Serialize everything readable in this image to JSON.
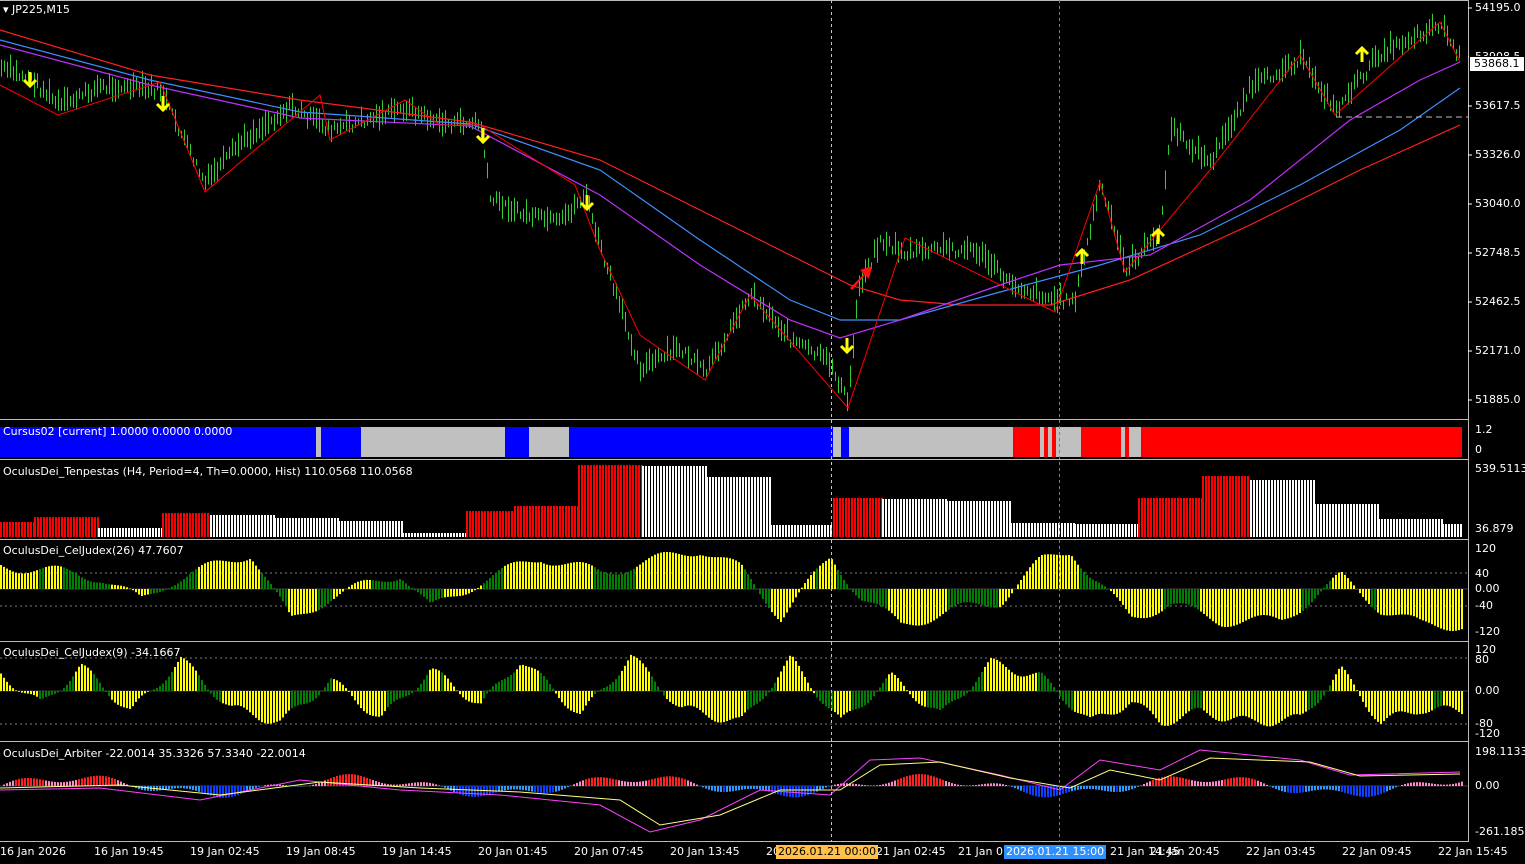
{
  "window": {
    "symbol_title": "JP225,M15",
    "current_price_label": "53868.1"
  },
  "main_axis": {
    "labels": [
      "54195.0",
      "53908.5",
      "53617.5",
      "53326.0",
      "53040.0",
      "52748.5",
      "52462.5",
      "52171.0",
      "51885.0"
    ]
  },
  "panels": [
    {
      "id": "cursus",
      "title": "Cursus02 [current] 1.0000 0.0000 0.0000",
      "axis": [
        "1.2",
        "0"
      ]
    },
    {
      "id": "tenpestas",
      "title": "OculusDei_Tenpestas (H4, Period=4, Th=0.0000, Hist) 110.0568 110.0568",
      "axis": [
        "539.5113",
        "36.879"
      ]
    },
    {
      "id": "celjudex26",
      "title": "OculusDei_CelJudex(26) 47.7607",
      "axis": [
        "120",
        "40",
        "0.00",
        "-40",
        "-120"
      ]
    },
    {
      "id": "celjudex9",
      "title": "OculusDei_CelJudex(9) -34.1667",
      "axis": [
        "120",
        "80",
        "0.00",
        "-80",
        "-120"
      ]
    },
    {
      "id": "arbiter",
      "title": "OculusDei_Arbiter -22.0014 35.3326 57.3340 -22.0014",
      "axis": [
        "198.1133",
        "0.00",
        "-261.1859"
      ]
    }
  ],
  "time_axis": {
    "labels": [
      "16 Jan 2026",
      "16 Jan 19:45",
      "19 Jan 02:45",
      "19 Jan 08:45",
      "19 Jan 14:45",
      "20 Jan 01:45",
      "20 Jan 07:45",
      "20 Jan 13:45",
      "20",
      "21 Jan 02:45",
      "21 Jan 0",
      "21 Jan 14:45",
      "21 Jan 20:45",
      "22 Jan 03:45",
      "22 Jan 09:45",
      "22 Jan 15:45"
    ],
    "cursor_label_1": "2026.01.21 00:00",
    "cursor_label_2": "2026.01.21 15:00"
  },
  "colors": {
    "background": "#000000",
    "bull_candle": "#32cd32",
    "ma_red": "#ff2020",
    "ma_blue": "#3f8fff",
    "ma_magenta": "#c030ff",
    "yellow": "#ffff00",
    "green": "#008000",
    "cursus_blue": "#0000ff",
    "cursus_gray": "#c0c0c0",
    "tenpestas_red": "#ff0000",
    "tenpestas_white": "#ffffff",
    "cursor1": "#ffc04a",
    "cursor2": "#2e8fff"
  }
}
